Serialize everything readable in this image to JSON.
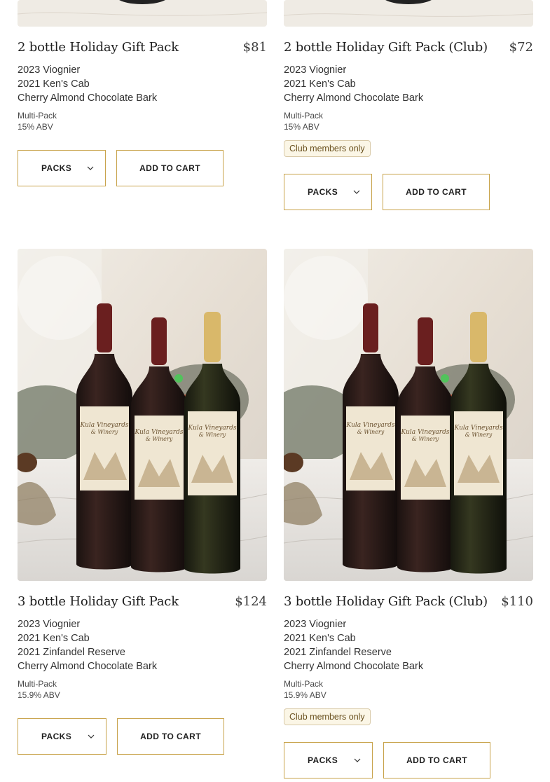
{
  "products": [
    {
      "title": "2 bottle Holiday Gift Pack",
      "price": "$81",
      "items": [
        "2023 Viognier",
        "2021 Ken's Cab",
        "Cherry Almond Chocolate Bark"
      ],
      "type": "Multi-Pack",
      "abv": "15% ABV",
      "select_label": "PACKS",
      "cart_label": "ADD TO CART"
    },
    {
      "title": "2 bottle Holiday Gift Pack (Club)",
      "price": "$72",
      "items": [
        "2023 Viognier",
        "2021 Ken's Cab",
        "Cherry Almond Chocolate Bark"
      ],
      "type": "Multi-Pack",
      "abv": "15% ABV",
      "badge": "Club members only",
      "select_label": "PACKS",
      "cart_label": "ADD TO CART"
    },
    {
      "title": "3 bottle Holiday Gift Pack",
      "price": "$124",
      "items": [
        "2023 Viognier",
        "2021 Ken's Cab",
        "2021 Zinfandel Reserve",
        "Cherry Almond Chocolate Bark"
      ],
      "type": "Multi-Pack",
      "abv": "15.9% ABV",
      "select_label": "PACKS",
      "cart_label": "ADD TO CART"
    },
    {
      "title": "3 bottle Holiday Gift Pack (Club)",
      "price": "$110",
      "items": [
        "2023 Viognier",
        "2021 Ken's Cab",
        "2021 Zinfandel Reserve",
        "Cherry Almond Chocolate Bark"
      ],
      "type": "Multi-Pack",
      "abv": "15.9% ABV",
      "badge": "Club members only",
      "select_label": "PACKS",
      "cart_label": "ADD TO CART"
    }
  ],
  "icons": {
    "select_chevron": "chevron-down-icon"
  },
  "colors": {
    "button_border": "#c8a34b",
    "badge_bg": "#fbf6e6"
  }
}
